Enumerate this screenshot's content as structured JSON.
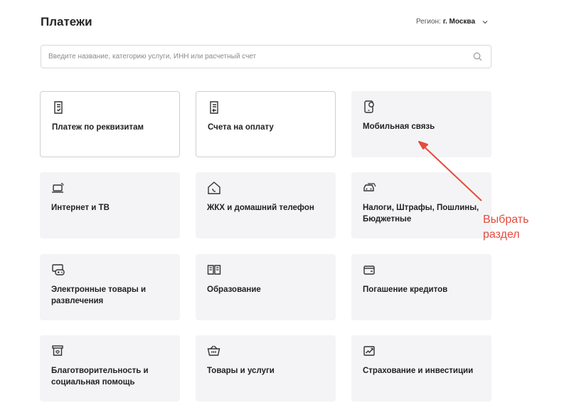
{
  "header": {
    "title": "Платежи",
    "region_label": "Регион:",
    "region_value": "г. Москва"
  },
  "search": {
    "placeholder": "Введите название, категорию услуги, ИНН или расчетный счет",
    "value": ""
  },
  "categories": [
    {
      "label": "Платеж по реквизитам",
      "icon": "document-check-icon"
    },
    {
      "label": "Счета на оплату",
      "icon": "invoice-return-icon"
    },
    {
      "label": "Мобильная связь",
      "icon": "mobile-phone-icon"
    },
    {
      "label": "Интернет и ТВ",
      "icon": "laptop-wifi-icon"
    },
    {
      "label": "ЖКХ и домашний телефон",
      "icon": "house-phone-icon"
    },
    {
      "label": "Налоги, Штрафы, Пошлины, Бюджетные",
      "icon": "car-icon"
    },
    {
      "label": "Электронные товары и развлечения",
      "icon": "gamepad-icon"
    },
    {
      "label": "Образование",
      "icon": "open-book-icon"
    },
    {
      "label": "Погашение кредитов",
      "icon": "wallet-icon"
    },
    {
      "label": "Благотворительность и социальная помощь",
      "icon": "charity-box-icon"
    },
    {
      "label": "Товары и услуги",
      "icon": "basket-icon"
    },
    {
      "label": "Страхование и инвестиции",
      "icon": "chart-growth-icon"
    }
  ],
  "annotation": {
    "line1": "Выбрать",
    "line2": "раздел",
    "color": "#e54b3c"
  }
}
